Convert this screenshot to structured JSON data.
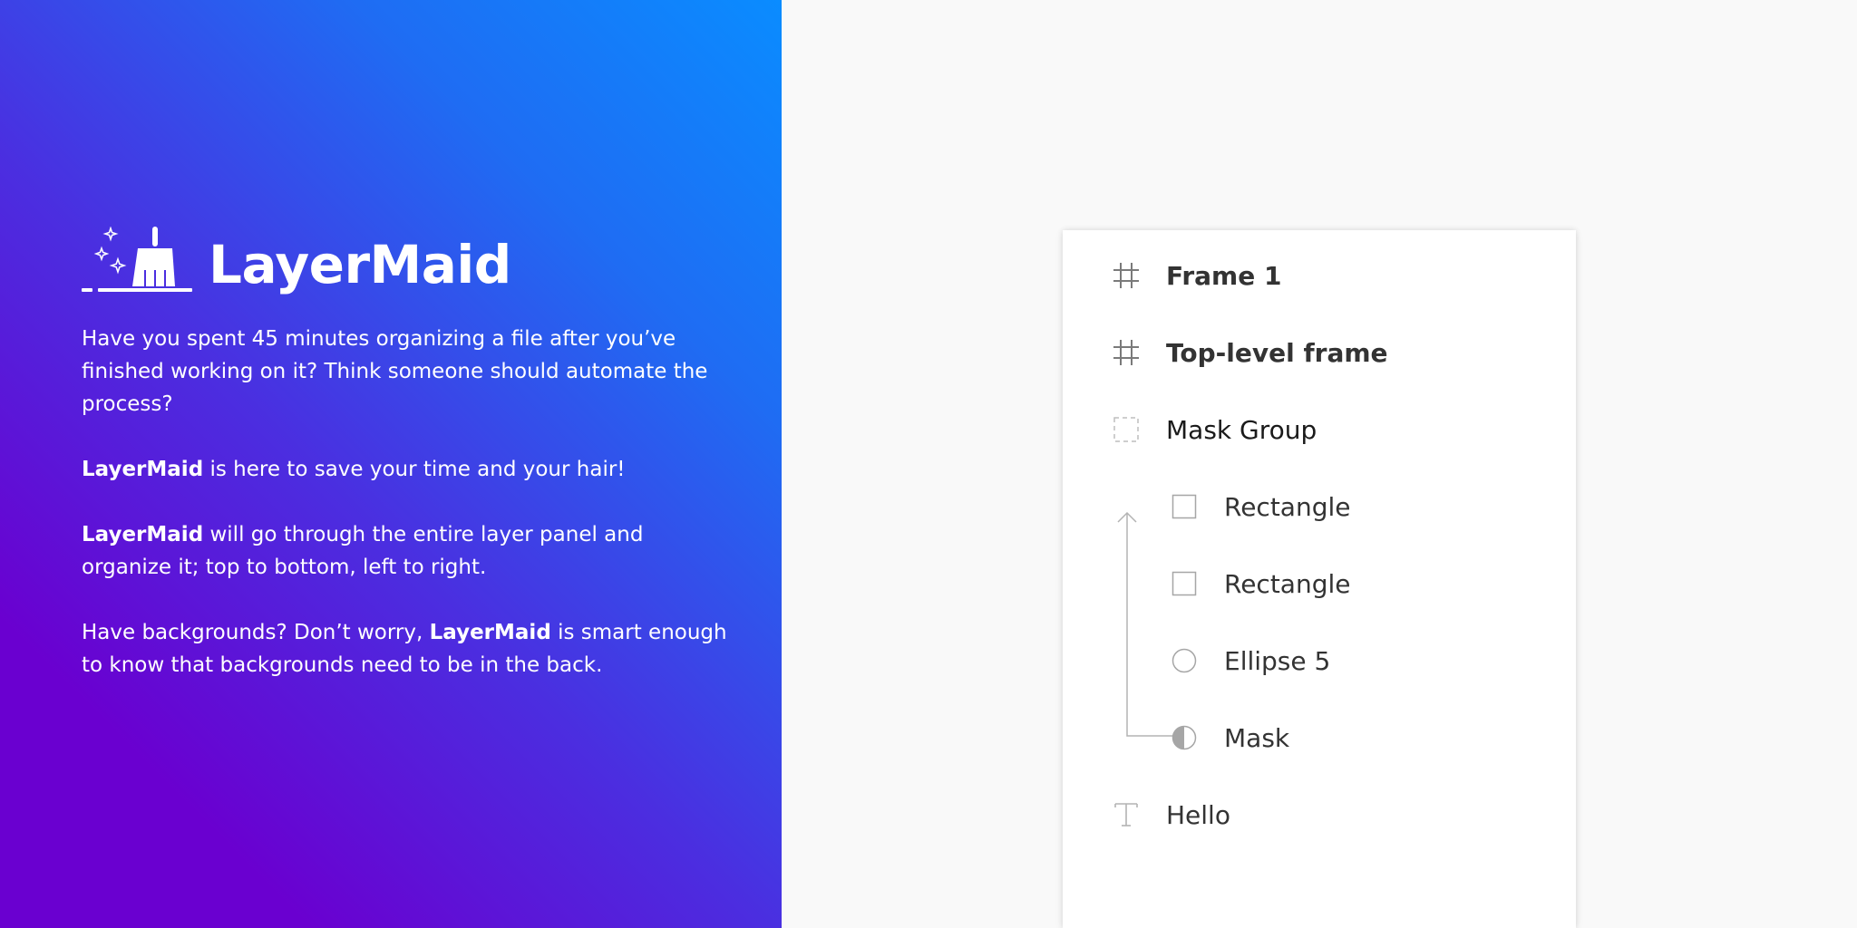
{
  "brand": {
    "name": "LayerMaid"
  },
  "intro": {
    "p1": "Have you spent 45 minutes organizing a file after you’ve finished working on it? Think someone should automate the process?",
    "p2_brand": "LayerMaid",
    "p2_rest": " is here to save your time and your hair!",
    "p3_brand": "LayerMaid",
    "p3_rest": " will go through the entire layer panel and organize it; top to bottom, left to right.",
    "p4_start": "Have backgrounds? Don’t worry, ",
    "p4_brand": "LayerMaid",
    "p4_rest": " is smart enough to know that backgrounds need to be in the back."
  },
  "layers": [
    {
      "label": "Frame 1",
      "icon": "frame-icon"
    },
    {
      "label": "Top-level frame",
      "icon": "frame-icon"
    },
    {
      "label": "Mask Group",
      "icon": "mask-group-icon"
    },
    {
      "label": "Rectangle",
      "icon": "rectangle-icon"
    },
    {
      "label": "Rectangle",
      "icon": "rectangle-icon"
    },
    {
      "label": "Ellipse 5",
      "icon": "ellipse-icon"
    },
    {
      "label": "Mask",
      "icon": "mask-icon"
    },
    {
      "label": "Hello",
      "icon": "text-icon"
    }
  ],
  "colors": {
    "gradient_start": "#6a00d0",
    "gradient_end": "#0a8cff",
    "panel_bg": "#ffffff",
    "page_bg": "#f9f9f9",
    "text_dark": "#333333",
    "icon_gray": "#b3b3b3"
  }
}
